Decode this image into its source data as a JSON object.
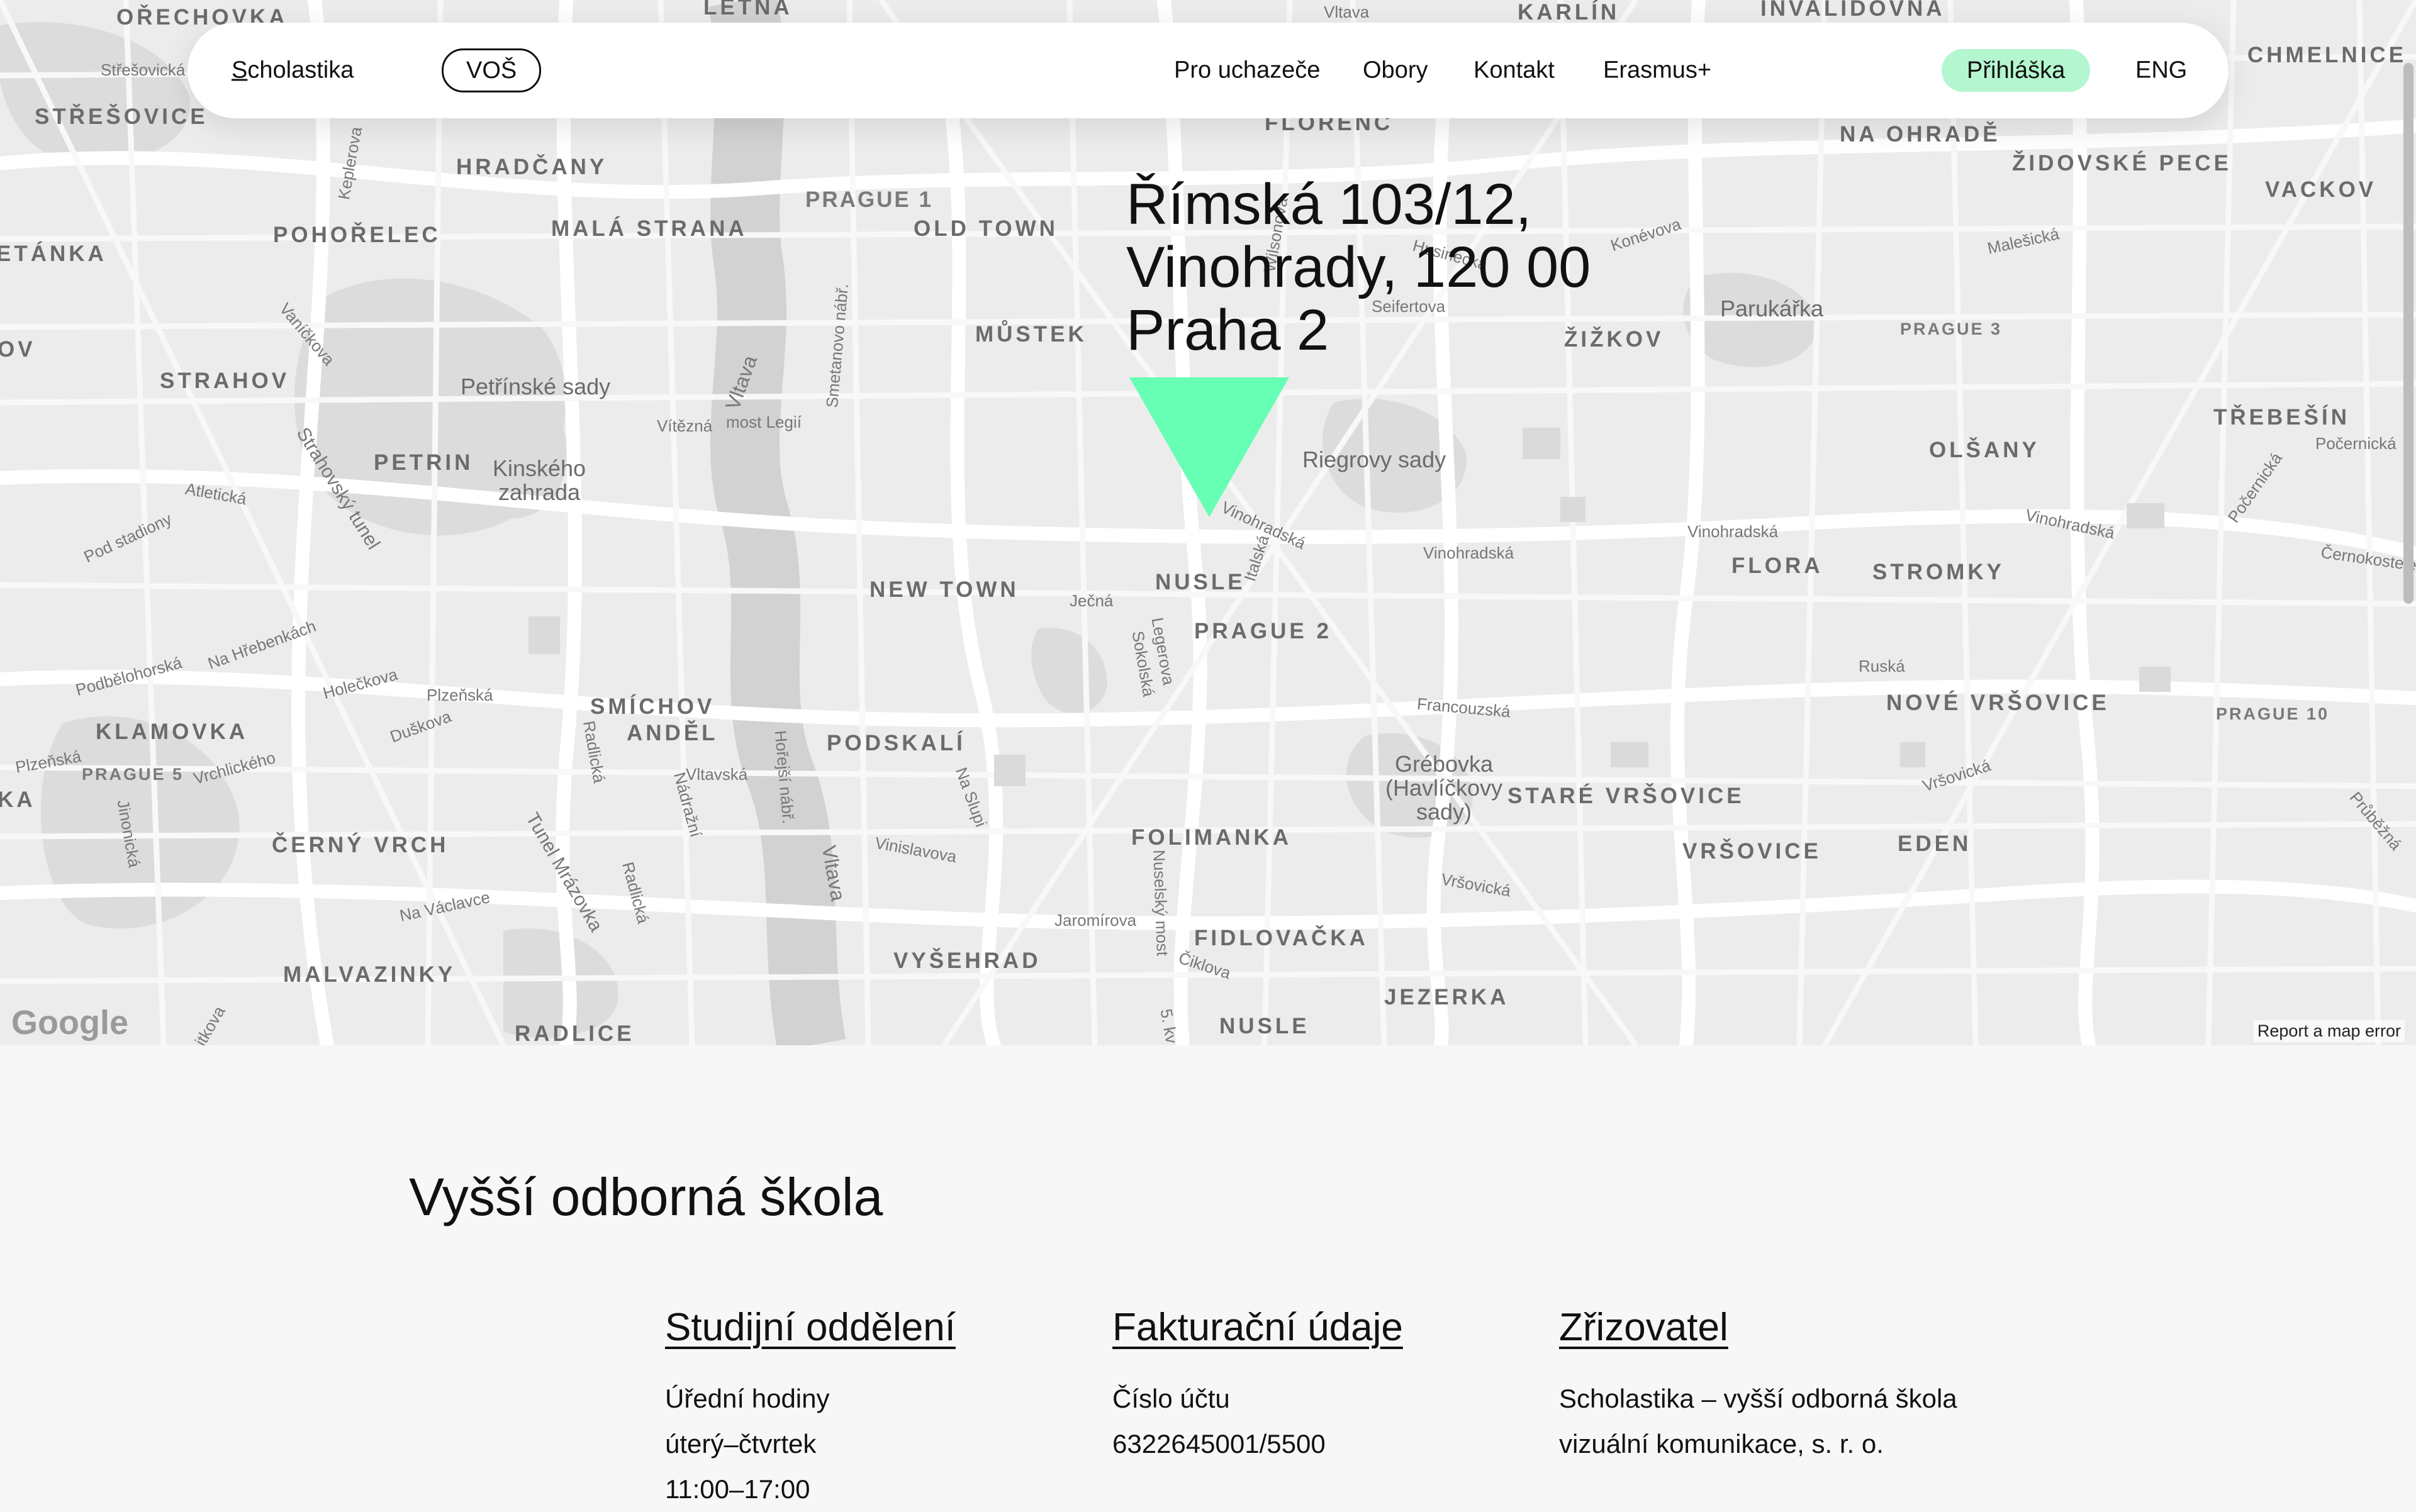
{
  "navbar": {
    "brand": "Scholastika",
    "badge": "VOŠ",
    "links": [
      "Pro uchazeče",
      "Obory",
      "Kontakt",
      "Erasmus+"
    ],
    "apply": "Přihláška",
    "language": "ENG"
  },
  "colors": {
    "accent": "#66ffb4",
    "apply_bg": "#b4f6cf",
    "map_bg": "#ececec",
    "page_bg": "#f7f7f7"
  },
  "map": {
    "address_lines": [
      "Římská 103/12,",
      "Vinohrady, 120 00",
      "Praha 2"
    ],
    "pin_icon": "triangle-down-marker",
    "google_logo": "Google",
    "report": "Report a map error",
    "districts": [
      "OŘECHOVKA",
      "LETNÁ",
      "KARLÍN",
      "INVALIDOVNA",
      "CHMELNICE",
      "STŘEŠOVICE",
      "HRADČANY",
      "FLORENC",
      "NA OHRADĚ",
      "ŽIDOVSKÉ PECE",
      "VACKOV",
      "POHOŘELEC",
      "MALÁ STRANA",
      "OLD TOWN",
      "ETÁNKA",
      "MŮSTEK",
      "ŽIŽKOV",
      "OV",
      "STRAHOV",
      "PETRIN",
      "TŘEBEŠÍN",
      "OLŠANY",
      "NEW TOWN",
      "NUSLE",
      "FLORA",
      "STROMKY",
      "PRAGUE 2",
      "KLAMOVKA",
      "SMÍCHOV",
      "ANDĚL",
      "PODSKALÍ",
      "NOVÉ VRŠOVICE",
      "STARÉ VRŠOVICE",
      "KA",
      "ČERNÝ VRCH",
      "FOLIMANKA",
      "VRŠOVICE",
      "EDEN",
      "MALVAZINKY",
      "VYŠEHRAD",
      "FIDLOVAČKA",
      "JEZERKA",
      "RADLICE",
      "NUSLE"
    ],
    "prague_labels": [
      "PRAGUE 1",
      "PRAGUE 3",
      "PRAGUE 5",
      "PRAGUE 10"
    ],
    "parks": [
      "Petřínské sady",
      "Kinského zahrada",
      "Parukářka",
      "Riegrovy sady",
      "Grébovka (Havlíčkovy sady)"
    ],
    "streets": [
      "Vltava",
      "Střešovická",
      "Keplerova",
      "Konévova",
      "Malešická",
      "Vaníčkova",
      "Husinecká",
      "Seifertova",
      "Smetanovo nábř.",
      "Vltava",
      "Vítězná",
      "most Legií",
      "Wilsonova",
      "Strahovský tunel",
      "Atletická",
      "Pod stadiony",
      "Vinohradská",
      "Vinohradská",
      "Vinohradská",
      "Vinohradská",
      "Počernická",
      "Počernická",
      "Černokostelecká",
      "Italská",
      "Ječná",
      "Legerova",
      "Sokolská",
      "Na Hřebenkách",
      "Podbělohorská",
      "Holečkova",
      "Plzeňská",
      "Duškova",
      "Plzeňská",
      "Vrchlického",
      "Radlická",
      "Vltavská",
      "Hořejší nábř.",
      "Nádražní",
      "Na Slupi",
      "Francouzská",
      "Ruská",
      "Vršovická",
      "Průběžná",
      "Jinonická",
      "Tunel Mrázovka",
      "Vltava",
      "Vinislavova",
      "Vršovická",
      "Na Václavce",
      "Radlická",
      "Jaromírova",
      "Nuselský most",
      "Čiklova",
      "5. kv",
      "itkova"
    ]
  },
  "content": {
    "title": "Vyšší odborná škola",
    "columns": [
      {
        "heading": "Studijní oddělení",
        "lines": [
          "Úřední hodiny",
          "úterý–čtvrtek",
          "11:00–17:00"
        ]
      },
      {
        "heading": "Fakturační údaje",
        "lines": [
          "Číslo účtu",
          "6322645001/5500"
        ]
      },
      {
        "heading": "Zřizovatel",
        "lines": [
          "Scholastika – vyšší odborná škola",
          "vizuální komunikace, s. r. o."
        ]
      }
    ]
  }
}
